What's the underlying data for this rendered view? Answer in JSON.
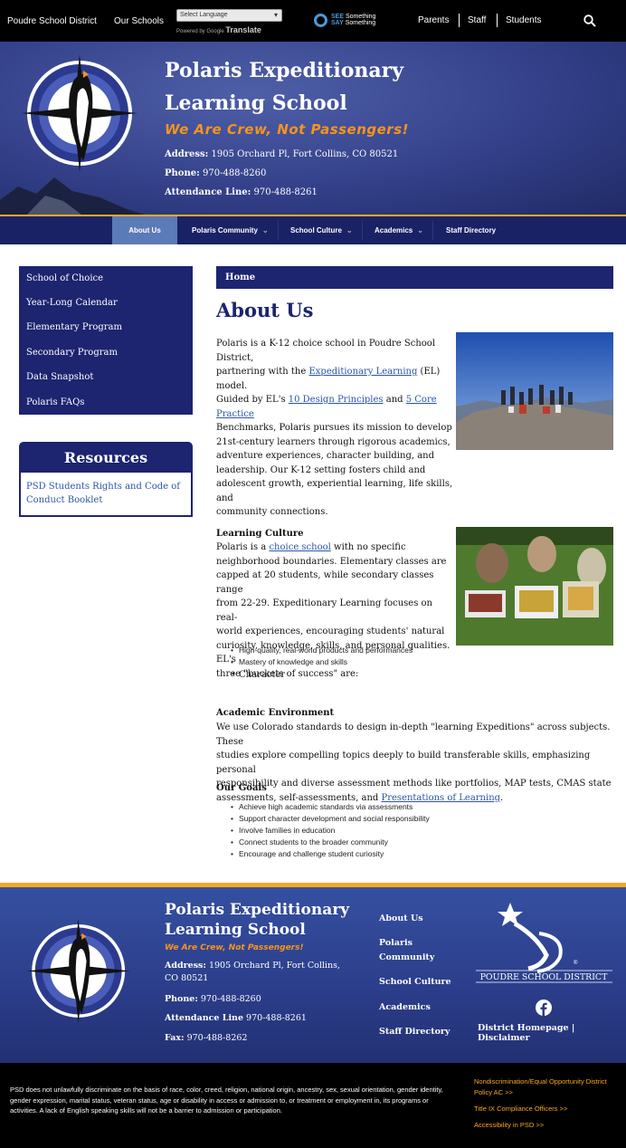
{
  "topbar": {
    "district": "Poudre School District",
    "our_schools": "Our Schools",
    "language_select": "Select Language",
    "powered_by": "Powered by",
    "google": "Google",
    "translate": "Translate",
    "see_something_1": "SEE",
    "see_something_1b": "Something",
    "see_something_2": "SAY",
    "see_something_2b": "Something",
    "parents": "Parents",
    "staff": "Staff",
    "students": "Students"
  },
  "hero": {
    "title_line1": "Polaris Expeditionary",
    "title_line2": "Learning School",
    "motto": "We Are Crew, Not Passengers!",
    "address_label": "Address:",
    "address": "1905 Orchard Pl, Fort Collins, CO 80521",
    "phone_label": "Phone:",
    "phone": "970-488-8260",
    "attendance_label": "Attendance Line:",
    "attendance": "970-488-8261"
  },
  "nav": {
    "items": [
      "About Us",
      "Polaris Community",
      "School Culture",
      "Academics",
      "Staff Directory"
    ]
  },
  "sidebar": {
    "items": [
      "School of Choice",
      "Year-Long Calendar",
      "Elementary Program",
      "Secondary Program",
      "Data Snapshot",
      "Polaris FAQs"
    ],
    "resources_title": "Resources",
    "resources_link": "PSD Students Rights and Code of Conduct Booklet"
  },
  "main": {
    "breadcrumb": "Home",
    "title": "About Us",
    "intro": {
      "l1": "Polaris is a K-12 choice school in Poudre School District,",
      "l2a": "partnering with the ",
      "l2link": "Expeditionary Learning",
      "l2b": " (EL) model.",
      "l3a": "Guided by EL's ",
      "l3link1": "10 Design Principles",
      "l3b": " and ",
      "l3link2": "5 Core Practice",
      "l4": "Benchmarks, Polaris pursues its mission to develop",
      "l5": "21st-century learners through rigorous academics,",
      "l6": "adventure experiences, character building, and",
      "l7": "leadership. Our K-12 setting fosters child and",
      "l8": "adolescent growth, experiential learning, life skills, and",
      "l9": "community connections."
    },
    "learning_culture": {
      "heading": "Learning Culture",
      "l1a": "Polaris is a ",
      "l1link": "choice school",
      "l1b": " with no specific",
      "l2": "neighborhood boundaries. Elementary classes are",
      "l3": "capped at 20 students, while secondary classes range",
      "l4": "from 22-29. Expeditionary Learning focuses on real-",
      "l5": "world experiences, encouraging students' natural",
      "l6": "curiosity, knowledge, skills, and personal qualities. EL's",
      "l7": "three \"buckets of success\" are:",
      "bullets": [
        "High-quality, real-world products and performances",
        "Mastery of knowledge and skills",
        "Character"
      ]
    },
    "academic": {
      "heading": "Academic Environment",
      "l1": "We use Colorado standards to design in-depth \"learning Expeditions\" across subjects. These",
      "l2": "studies explore compelling topics deeply to build transferable skills, emphasizing personal",
      "l3": "responsibility and diverse assessment methods like portfolios, MAP tests, CMAS state",
      "l4a": "assessments, self-assessments, and ",
      "l4link": "Presentations of Learning",
      "l4b": "."
    },
    "goals": {
      "heading": "Our Goals",
      "bullets": [
        "Achieve high academic standards via assessments",
        "Support character development and social responsibility",
        "Involve families in education",
        "Connect students to the broader community",
        "Encourage and challenge student curiosity"
      ]
    }
  },
  "footer": {
    "title": "Polaris Expeditionary Learning School",
    "motto": "We Are Crew, Not Passengers!",
    "address_label": "Address:",
    "address": "1905 Orchard Pl, Fort Collins, CO 80521",
    "phone_label": "Phone:",
    "phone": "970-488-8260",
    "attendance_label": "Attendance Line",
    "attendance": "970-488-8261",
    "fax_label": "Fax:",
    "fax": "970-488-8262",
    "links": [
      "About Us",
      "Polaris Community",
      "School Culture",
      "Academics",
      "Staff Directory"
    ],
    "psd_name": "POUDRE SCHOOL DISTRICT",
    "district_homepage": "District Homepage",
    "disclaimer": "Disclaimer",
    "divider": "|"
  },
  "legal": {
    "text": "PSD does not unlawfully discriminate on the basis of race, color, creed, religion, national origin, ancestry, sex, sexual orientation, gender identity, gender expression, marital status, veteran status, age or disability in access or admission to, or treatment or employment in, its programs or activities. A lack of English speaking skills will not be a barrier to admission or participation.",
    "link1": "Nondiscrimination/Equal Opportunity District Policy AC >>",
    "link2": "Title IX Compliance Officers >>",
    "link3": "Accessibility in PSD >>"
  },
  "colors": {
    "navy": "#1d2470",
    "orange": "#f7941e",
    "link": "#2a55a8"
  }
}
